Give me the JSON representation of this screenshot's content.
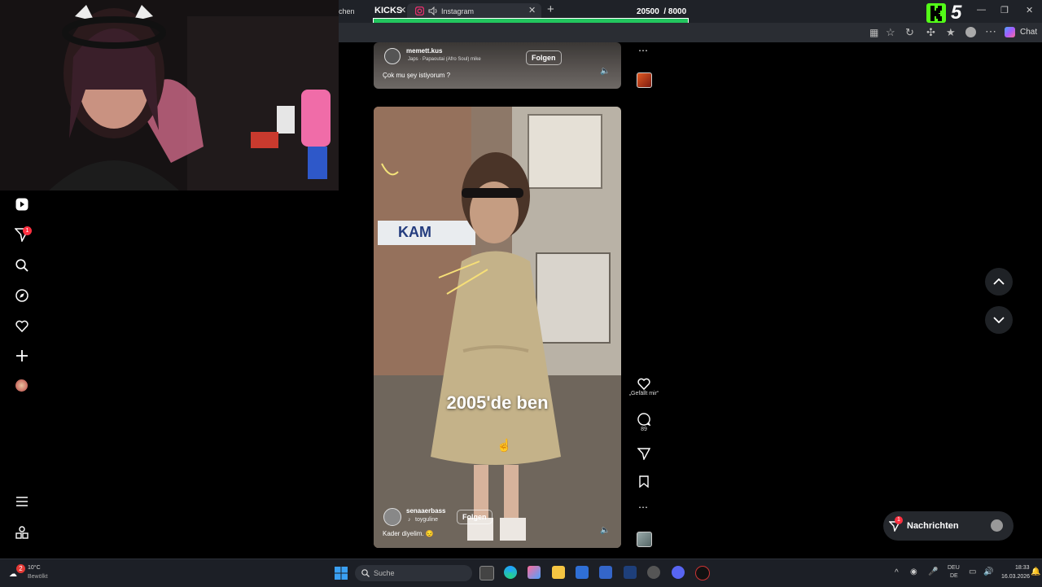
{
  "browser": {
    "prev_tab_fragment": "chen",
    "kicks_tab_label": "KICKS",
    "active_tab_title": "Instagram",
    "counter": "20500  / 8000",
    "chat_label": "Chat"
  },
  "overlay": {
    "badge_text": "5"
  },
  "sidebar": {
    "notification_count": "1"
  },
  "reel_top": {
    "username": "memett.kus",
    "audio": "Japs · Papaoutai (Afro Soul)   mike",
    "follow_label": "Folgen",
    "caption": "Çok mu şey istiyorum ?"
  },
  "reel_main": {
    "overlay_text": "2005'de ben",
    "username": "senaaerbass",
    "audio": "toyguline",
    "follow_label": "Folgen",
    "caption": "Kader diyelim. 😔",
    "like_label": "„Gefällt mir“",
    "comment_count": "89"
  },
  "messages": {
    "label": "Nachrichten",
    "badge": "1"
  },
  "taskbar": {
    "weather_temp": "10°C",
    "weather_desc": "Bewölkt",
    "search_placeholder": "Suche",
    "lang_top": "DEU",
    "lang_bottom": "DE",
    "time": "18:33",
    "date": "16.03.2026",
    "weather_badge": "2"
  },
  "colors": {
    "accent_green": "#22c55e",
    "badge_red": "#ff3040",
    "kick_green": "#53fc18"
  }
}
